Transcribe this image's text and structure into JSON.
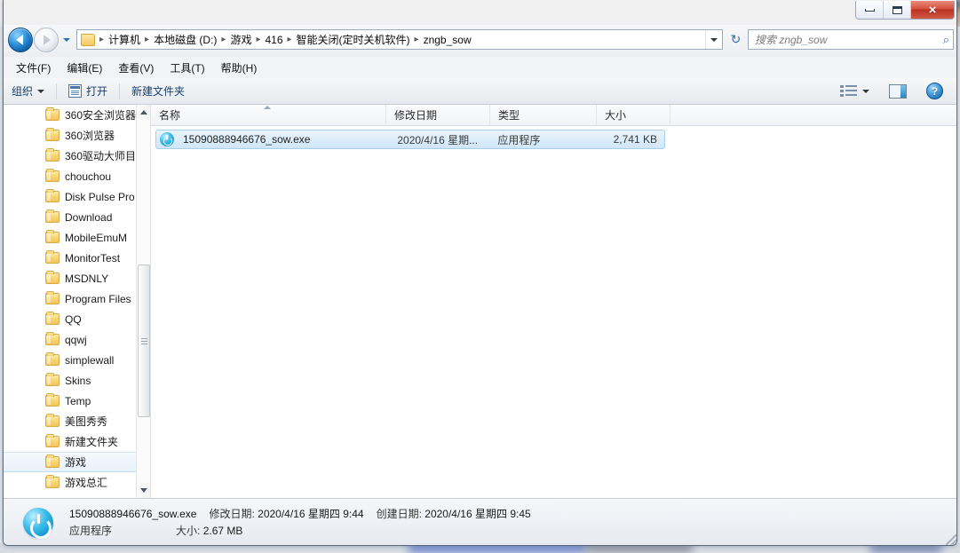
{
  "window": {
    "controls": {
      "minimize_label": "最小化",
      "maximize_label": "最大化",
      "close_label": "×"
    }
  },
  "nav": {
    "back_label": "后退",
    "forward_label": "前进",
    "recent_dropdown_label": "最近访问的位置",
    "refresh_label": "刷新",
    "refresh_glyph": "↻"
  },
  "address": {
    "breadcrumbs": [
      "计算机",
      "本地磁盘 (D:)",
      "游戏",
      "416",
      "智能关闭(定时关机软件)",
      "zngb_sow"
    ],
    "separator": "▸"
  },
  "search": {
    "placeholder": "搜索 zngb_sow",
    "icon_glyph": "⌕"
  },
  "menubar": {
    "items": [
      {
        "label": "文件(F)"
      },
      {
        "label": "编辑(E)"
      },
      {
        "label": "查看(V)"
      },
      {
        "label": "工具(T)"
      },
      {
        "label": "帮助(H)"
      }
    ]
  },
  "toolbar": {
    "organize_label": "组织",
    "open_label": "打开",
    "new_folder_label": "新建文件夹",
    "help_glyph": "?"
  },
  "navpane": {
    "items": [
      {
        "label": "360安全浏览器",
        "selected": false
      },
      {
        "label": "360浏览器",
        "selected": false
      },
      {
        "label": "360驱动大师目",
        "selected": false
      },
      {
        "label": "chouchou",
        "selected": false
      },
      {
        "label": "Disk Pulse Pro",
        "selected": false
      },
      {
        "label": "Download",
        "selected": false
      },
      {
        "label": "MobileEmuM",
        "selected": false
      },
      {
        "label": "MonitorTest",
        "selected": false
      },
      {
        "label": "MSDNLY",
        "selected": false
      },
      {
        "label": "Program Files",
        "selected": false
      },
      {
        "label": "QQ",
        "selected": false
      },
      {
        "label": "qqwj",
        "selected": false
      },
      {
        "label": "simplewall",
        "selected": false
      },
      {
        "label": "Skins",
        "selected": false
      },
      {
        "label": "Temp",
        "selected": false
      },
      {
        "label": "美图秀秀",
        "selected": false
      },
      {
        "label": "新建文件夹",
        "selected": false
      },
      {
        "label": "游戏",
        "selected": true
      },
      {
        "label": "游戏总汇",
        "selected": false
      }
    ]
  },
  "filelist": {
    "columns": [
      {
        "label": "名称",
        "sorted": true
      },
      {
        "label": "修改日期",
        "sorted": false
      },
      {
        "label": "类型",
        "sorted": false
      },
      {
        "label": "大小",
        "sorted": false
      }
    ],
    "rows": [
      {
        "name": "15090888946676_sow.exe",
        "date": "2020/4/16 星期...",
        "type": "应用程序",
        "size": "2,741 KB",
        "selected": true
      }
    ]
  },
  "details": {
    "filename": "15090888946676_sow.exe",
    "modified_label": "修改日期:",
    "modified_value": "2020/4/16 星期四 9:44",
    "created_label": "创建日期:",
    "created_value": "2020/4/16 星期四 9:45",
    "type_value": "应用程序",
    "size_label": "大小:",
    "size_value": "2.67 MB"
  },
  "colors": {
    "accent": "#2a8fd8",
    "selection": "#cfe6f8",
    "close_button": "#b93222",
    "folder": "#f2c45b"
  }
}
